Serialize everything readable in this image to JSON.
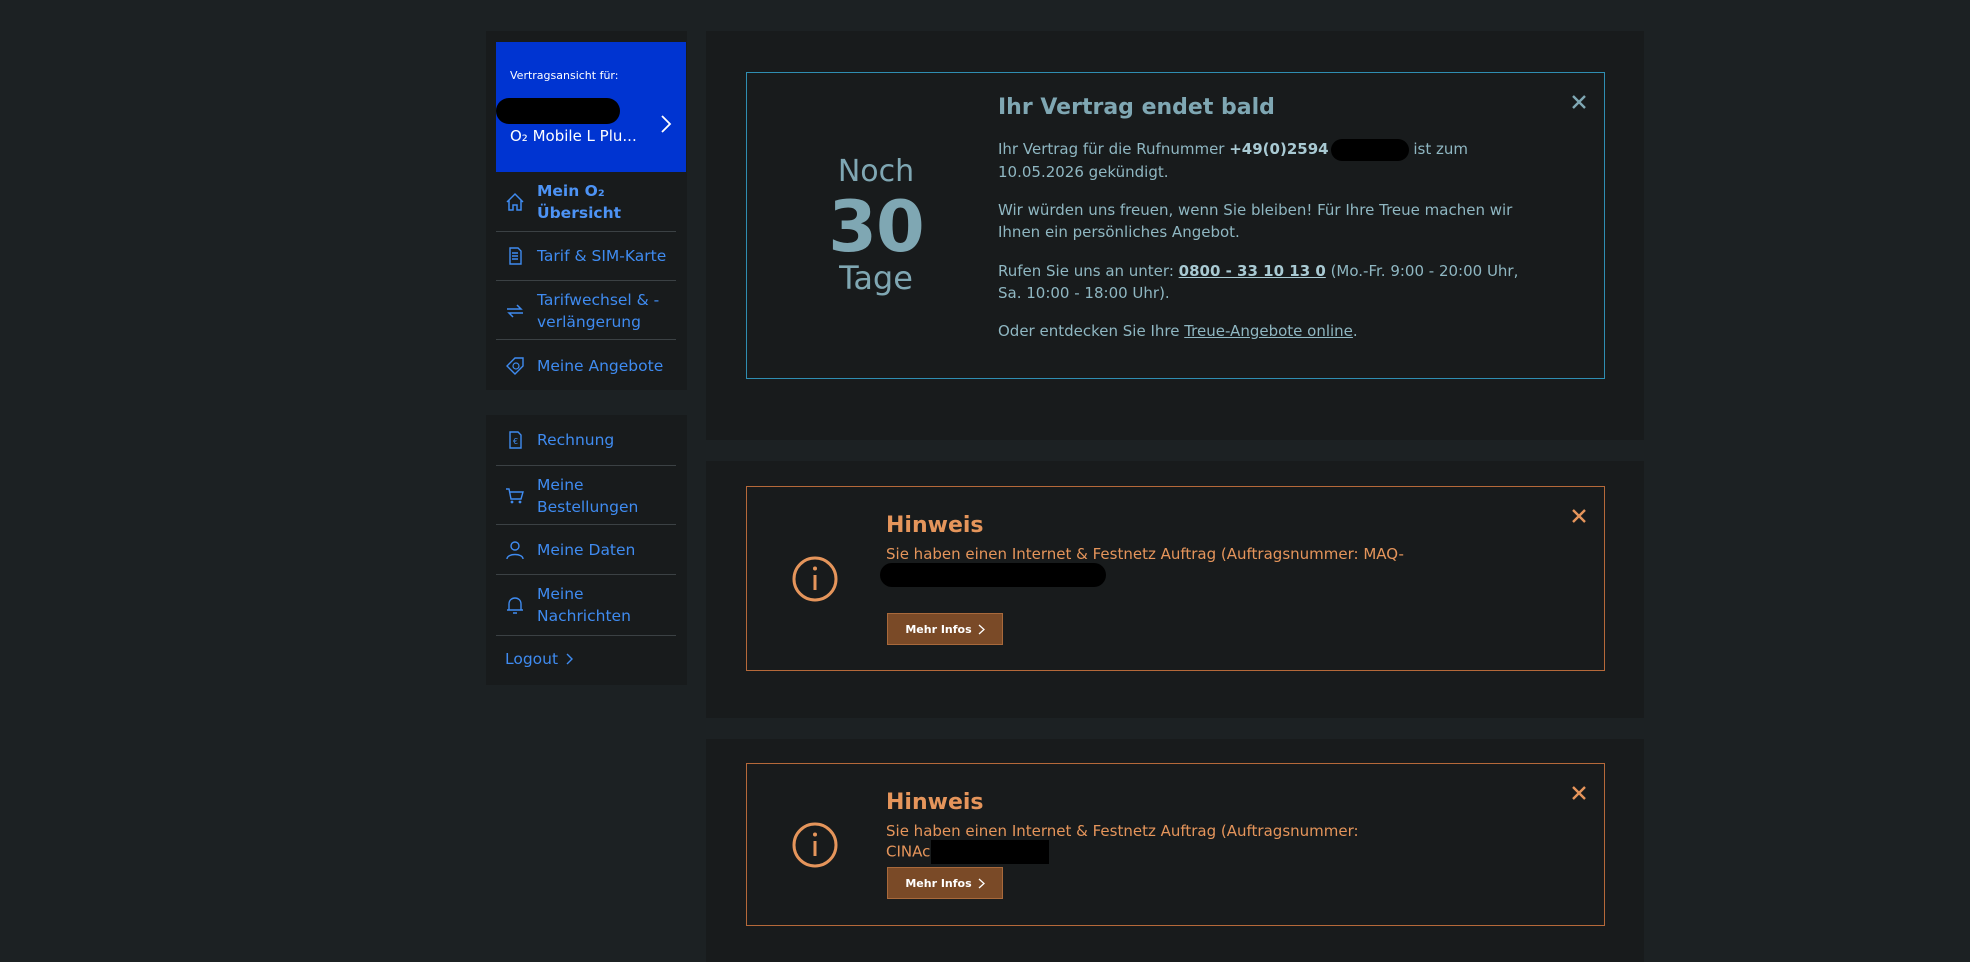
{
  "sidebar": {
    "contract_card": {
      "label": "Vertragsansicht für:",
      "plan": "O₂ Mobile L Plu..."
    },
    "nav_primary": [
      {
        "label": "Mein O₂\nÜbersicht",
        "icon": "home-icon",
        "active": true
      },
      {
        "label": "Tarif & SIM-Karte",
        "icon": "document-icon"
      },
      {
        "label": "Tarifwechsel & -\nverlängerung",
        "icon": "swap-arrows-icon"
      },
      {
        "label": "Meine Angebote",
        "icon": "tag-euro-icon"
      }
    ],
    "nav_secondary": [
      {
        "label": "Rechnung",
        "icon": "invoice-euro-icon"
      },
      {
        "label": "Meine\nBestellungen",
        "icon": "cart-icon"
      },
      {
        "label": "Meine Daten",
        "icon": "user-icon"
      },
      {
        "label": "Meine\nNachrichten",
        "icon": "bell-icon"
      }
    ],
    "logout": "Logout"
  },
  "contract_end": {
    "noch": "Noch",
    "days": "30",
    "tage": "Tage",
    "title": "Ihr Vertrag endet bald",
    "p1_pre": "Ihr Vertrag für die Rufnummer ",
    "p1_number": "+49(0)2594",
    "p1_post": " ist zum 10.05.2026 gekündigt.",
    "p2": "Wir würden uns freuen, wenn Sie bleiben! Für Ihre Treue machen wir Ihnen ein persönliches Angebot.",
    "p3_pre": "Rufen Sie uns an unter: ",
    "p3_phone": "0800 - 33 10 13 0",
    "p3_post": " (Mo.-Fr. 9:00 - 20:00 Uhr, Sa. 10:00 - 18:00 Uhr).",
    "p4_pre": "Oder entdecken Sie Ihre ",
    "p4_link": "Treue-Angebote online",
    "p4_post": "."
  },
  "notices": [
    {
      "title": "Hinweis",
      "text": "Sie haben einen Internet & Festnetz Auftrag (Auftragsnummer: MAQ-",
      "button": "Mehr Infos"
    },
    {
      "title": "Hinweis",
      "text": "Sie haben einen Internet & Festnetz Auftrag (Auftragsnummer: CINAc",
      "button": "Mehr Infos"
    }
  ],
  "colors": {
    "background": "#1c2123",
    "panel": "#181b1c",
    "brand_blue": "#0034d1",
    "link_blue": "#3f8bf0",
    "teal_text": "#7fa7b3",
    "teal_border": "#2f8eb2",
    "orange": "#e5955b",
    "orange_border": "#b5693a",
    "button_brown": "#7a4a27"
  }
}
